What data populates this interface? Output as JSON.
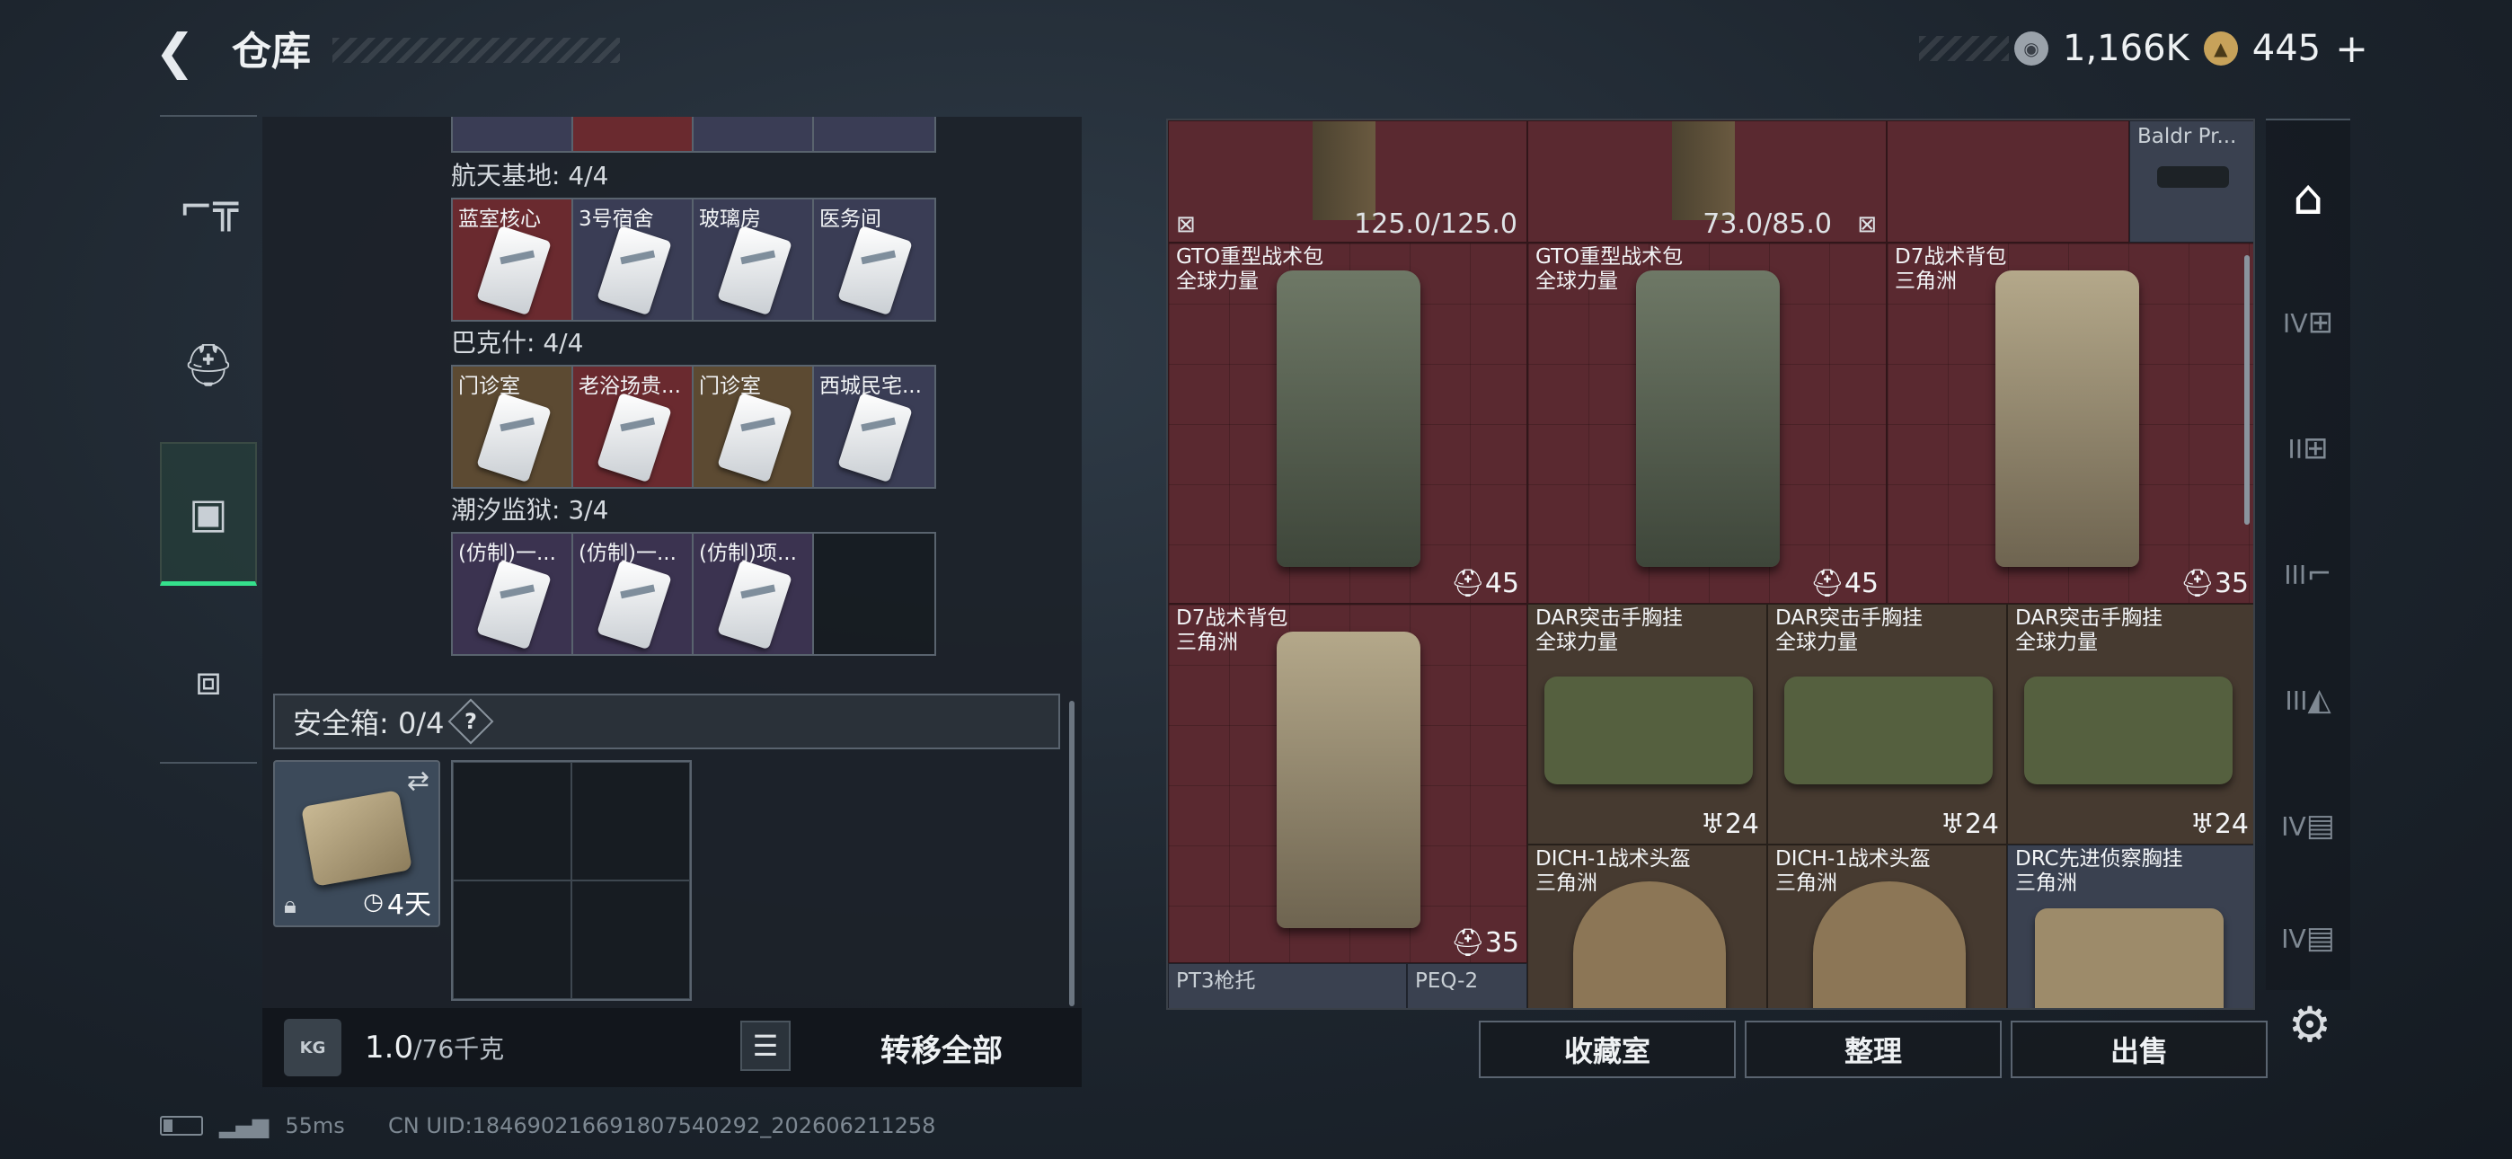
{
  "header": {
    "title": "仓库",
    "back_icon": "back-arrow-icon"
  },
  "currency": [
    {
      "icon": "silver-coin-icon",
      "value": "1,166K"
    },
    {
      "icon": "gold-triangle-coin-icon",
      "value": "445",
      "add": "+"
    }
  ],
  "left_nav": [
    {
      "icon": "pistol-icon",
      "active": false
    },
    {
      "icon": "backpack-icon",
      "active": false
    },
    {
      "icon": "clipboard-icon",
      "active": true
    },
    {
      "icon": "toolbox-icon",
      "active": false
    }
  ],
  "key_groups": [
    {
      "title": "航天基地: 4/4",
      "keys": [
        {
          "label": "蓝室核心",
          "bg": "red"
        },
        {
          "label": "3号宿舍",
          "bg": "blue"
        },
        {
          "label": "玻璃房",
          "bg": "blue"
        },
        {
          "label": "医务间",
          "bg": "blue"
        }
      ]
    },
    {
      "title": "巴克什: 4/4",
      "keys": [
        {
          "label": "门诊室",
          "bg": "gold"
        },
        {
          "label": "老浴场贵...",
          "bg": "red"
        },
        {
          "label": "门诊室",
          "bg": "gold"
        },
        {
          "label": "西城民宅...",
          "bg": "blue"
        }
      ]
    },
    {
      "title": "潮汐监狱: 3/4",
      "keys": [
        {
          "label": "(仿制)一...",
          "bg": "purple"
        },
        {
          "label": "(仿制)一...",
          "bg": "purple"
        },
        {
          "label": "(仿制)项...",
          "bg": "purple"
        },
        {
          "label": "",
          "bg": "empty"
        }
      ]
    }
  ],
  "safe_box": {
    "label": "安全箱: 0/4",
    "help": "?",
    "item_time": "4天"
  },
  "weight": {
    "current": "1.0",
    "max": "/76千克",
    "kg_label": "KG"
  },
  "transfer_all": "转移全部",
  "inventory": {
    "top_row": {
      "left_durability": "125.0/125.0",
      "right_durability": "73.0/85.0",
      "corner_item": "Baldr Pr..."
    },
    "items": [
      {
        "name": "GTO重型战术包",
        "sub": "全球力量",
        "count": "45"
      },
      {
        "name": "GTO重型战术包",
        "sub": "全球力量",
        "count": "45"
      },
      {
        "name": "D7战术背包",
        "sub": "三角洲",
        "count": "35"
      },
      {
        "name": "D7战术背包",
        "sub": "三角洲",
        "count": "35"
      },
      {
        "name": "DAR突击手胸挂",
        "sub": "全球力量",
        "count": "24"
      },
      {
        "name": "DAR突击手胸挂",
        "sub": "全球力量",
        "count": "24"
      },
      {
        "name": "DAR突击手胸挂",
        "sub": "全球力量",
        "count": "24"
      },
      {
        "name": "DICH-1战术头盔",
        "sub": "三角洲",
        "count": ""
      },
      {
        "name": "DICH-1战术头盔",
        "sub": "三角洲",
        "count": ""
      },
      {
        "name": "DRC先进侦察胸挂",
        "sub": "三角洲",
        "count": ""
      }
    ],
    "bottom_labels": [
      "PT3枪托",
      "PEQ-2"
    ]
  },
  "buttons": {
    "collection": "收藏室",
    "sort": "整理",
    "sell": "出售"
  },
  "right_nav": [
    {
      "icon": "warehouse-icon",
      "tier": ""
    },
    {
      "icon": "add-storage-icon",
      "tier": "IV"
    },
    {
      "icon": "add-storage-icon",
      "tier": "II"
    },
    {
      "icon": "gun-rack-icon",
      "tier": "III"
    },
    {
      "icon": "cabinet-icon",
      "tier": "III"
    },
    {
      "icon": "shelf-icon",
      "tier": "IV"
    },
    {
      "icon": "shelf-icon",
      "tier": "IV"
    }
  ],
  "status": {
    "ping": "55ms",
    "uid": "CN UID:18469021669180​7540292_202606211258"
  }
}
